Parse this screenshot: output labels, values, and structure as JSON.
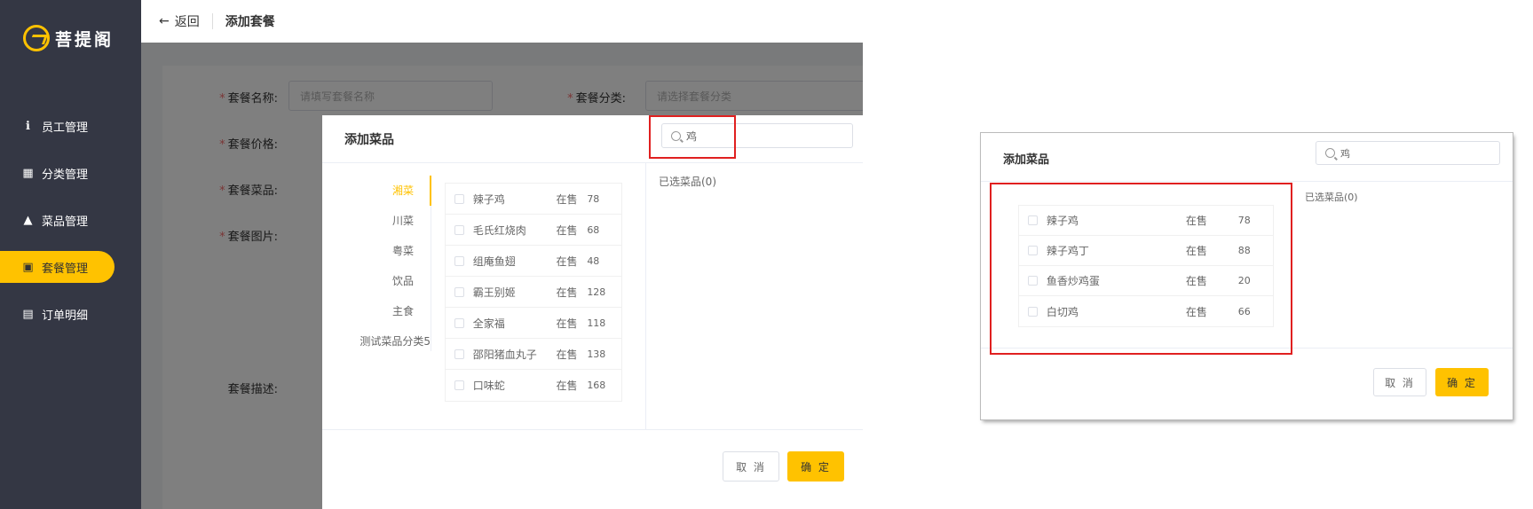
{
  "left": {
    "logo_text": "菩提阁",
    "nav": [
      {
        "label": "员工管理",
        "icon": "info-circle-icon",
        "glyph": "ℹ"
      },
      {
        "label": "分类管理",
        "icon": "grid-icon",
        "glyph": "▦"
      },
      {
        "label": "菜品管理",
        "icon": "dish-cover-icon",
        "glyph": "▲"
      },
      {
        "label": "套餐管理",
        "icon": "gift-icon",
        "glyph": "▣"
      },
      {
        "label": "订单明细",
        "icon": "clipboard-icon",
        "glyph": "▤"
      }
    ],
    "topbar": {
      "back_label": "返回",
      "title": "添加套餐"
    },
    "form": {
      "name_label": "套餐名称:",
      "name_placeholder": "请填写套餐名称",
      "category_label": "套餐分类:",
      "category_placeholder": "请选择套餐分类",
      "price_label": "套餐价格:",
      "dishes_label": "套餐菜品:",
      "image_label": "套餐图片:",
      "desc_label": "套餐描述:"
    },
    "dialog": {
      "title": "添加菜品",
      "search_value": "鸡",
      "categories": [
        "湘菜",
        "川菜",
        "粤菜",
        "饮品",
        "主食",
        "测试菜品分类5"
      ],
      "dishes": [
        {
          "name": "辣子鸡",
          "status": "在售",
          "price": "78"
        },
        {
          "name": "毛氏红烧肉",
          "status": "在售",
          "price": "68"
        },
        {
          "name": "组庵鱼翅",
          "status": "在售",
          "price": "48"
        },
        {
          "name": "霸王别姬",
          "status": "在售",
          "price": "128"
        },
        {
          "name": "全家福",
          "status": "在售",
          "price": "118"
        },
        {
          "name": "邵阳猪血丸子",
          "status": "在售",
          "price": "138"
        },
        {
          "name": "口味蛇",
          "status": "在售",
          "price": "168"
        }
      ],
      "selected_label": "已选菜品(0)",
      "cancel_label": "取 消",
      "ok_label": "确 定"
    }
  },
  "right": {
    "title": "添加菜品",
    "search_value": "鸡",
    "dishes": [
      {
        "name": "辣子鸡",
        "status": "在售",
        "price": "78"
      },
      {
        "name": "辣子鸡丁",
        "status": "在售",
        "price": "88"
      },
      {
        "name": "鱼香炒鸡蛋",
        "status": "在售",
        "price": "20"
      },
      {
        "name": "白切鸡",
        "status": "在售",
        "price": "66"
      }
    ],
    "selected_label": "已选菜品(0)",
    "cancel_label": "取 消",
    "ok_label": "确 定"
  },
  "colors": {
    "accent": "#ffc200",
    "sidebar": "#343744",
    "highlight": "#e02020"
  }
}
